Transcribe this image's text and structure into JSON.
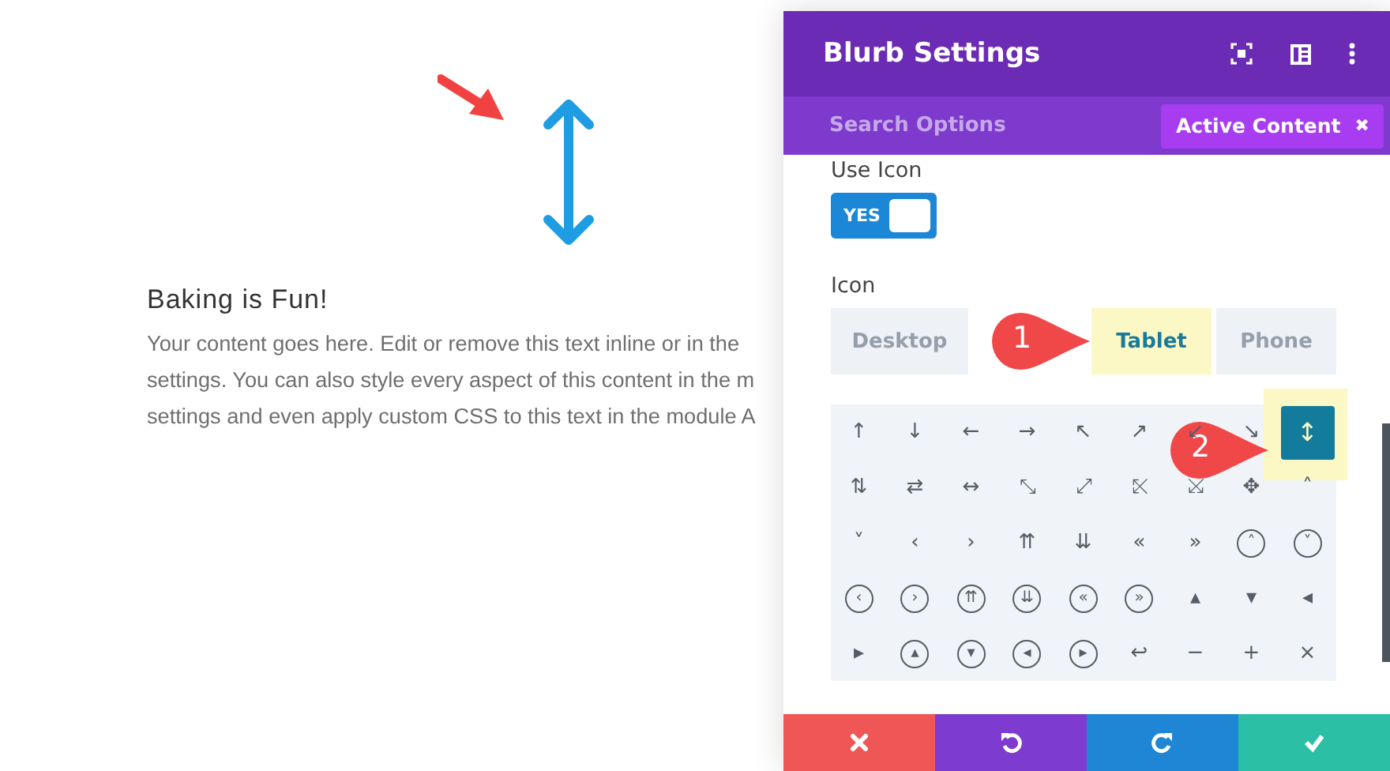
{
  "page": {
    "heading": "Baking is Fun!",
    "body_lines": [
      "Your content goes here. Edit or remove this text inline or in the",
      "settings. You can also style every aspect of this content in the m",
      "settings and even apply custom CSS to this text in the module A"
    ]
  },
  "panel": {
    "title": "Blurb Settings",
    "search": {
      "placeholder": "Search Options"
    },
    "filter_button": {
      "label": "Active Content",
      "close": "✖"
    },
    "use_icon": {
      "label": "Use Icon",
      "toggle": {
        "on": true,
        "label": "YES"
      }
    },
    "icon": {
      "label": "Icon",
      "tabs": [
        {
          "label": "Desktop",
          "selected": false
        },
        {
          "label": "Tablet",
          "selected": true
        },
        {
          "label": "Phone",
          "selected": false
        }
      ],
      "glyphs": [
        {
          "glyph": "↑",
          "kind": "plain",
          "selected": false
        },
        {
          "glyph": "↓",
          "kind": "plain",
          "selected": false
        },
        {
          "glyph": "←",
          "kind": "plain",
          "selected": false
        },
        {
          "glyph": "→",
          "kind": "plain",
          "selected": false
        },
        {
          "glyph": "↖",
          "kind": "plain",
          "selected": false
        },
        {
          "glyph": "↗",
          "kind": "plain",
          "selected": false
        },
        {
          "glyph": "↙",
          "kind": "plain",
          "selected": false
        },
        {
          "glyph": "↘",
          "kind": "plain",
          "selected": false
        },
        {
          "glyph": "↕",
          "kind": "plain",
          "selected": true
        },
        {
          "glyph": "⇅",
          "kind": "plain",
          "selected": false
        },
        {
          "glyph": "⇄",
          "kind": "plain",
          "selected": false
        },
        {
          "glyph": "↔",
          "kind": "plain",
          "selected": false
        },
        {
          "glyph": "⤡",
          "kind": "plain",
          "selected": false
        },
        {
          "glyph": "⤢",
          "kind": "plain",
          "selected": false
        },
        {
          "glyph": "⤪",
          "kind": "plain",
          "selected": false
        },
        {
          "glyph": "⤩",
          "kind": "plain",
          "selected": false
        },
        {
          "glyph": "✥",
          "kind": "plain",
          "selected": false
        },
        {
          "glyph": "˄",
          "kind": "plain",
          "selected": false
        },
        {
          "glyph": "˅",
          "kind": "plain",
          "selected": false
        },
        {
          "glyph": "‹",
          "kind": "plain",
          "selected": false
        },
        {
          "glyph": "›",
          "kind": "plain",
          "selected": false
        },
        {
          "glyph": "⇈",
          "kind": "plain",
          "selected": false
        },
        {
          "glyph": "⇊",
          "kind": "plain",
          "selected": false
        },
        {
          "glyph": "«",
          "kind": "plain",
          "selected": false
        },
        {
          "glyph": "»",
          "kind": "plain",
          "selected": false
        },
        {
          "glyph": "˄",
          "kind": "circled",
          "selected": false
        },
        {
          "glyph": "˅",
          "kind": "circled",
          "selected": false
        },
        {
          "glyph": "‹",
          "kind": "circled",
          "selected": false
        },
        {
          "glyph": "›",
          "kind": "circled",
          "selected": false
        },
        {
          "glyph": "⇈",
          "kind": "circled",
          "selected": false
        },
        {
          "glyph": "⇊",
          "kind": "circled",
          "selected": false
        },
        {
          "glyph": "«",
          "kind": "circled",
          "selected": false
        },
        {
          "glyph": "»",
          "kind": "circled",
          "selected": false
        },
        {
          "glyph": "▴",
          "kind": "plain",
          "selected": false
        },
        {
          "glyph": "▾",
          "kind": "plain",
          "selected": false
        },
        {
          "glyph": "◂",
          "kind": "plain",
          "selected": false
        },
        {
          "glyph": "▸",
          "kind": "plain",
          "selected": false
        },
        {
          "glyph": "▴",
          "kind": "circled",
          "selected": false
        },
        {
          "glyph": "▾",
          "kind": "circled",
          "selected": false
        },
        {
          "glyph": "◂",
          "kind": "circled",
          "selected": false
        },
        {
          "glyph": "▸",
          "kind": "circled",
          "selected": false
        },
        {
          "glyph": "↩",
          "kind": "plain",
          "selected": false
        },
        {
          "glyph": "−",
          "kind": "plain",
          "selected": false
        },
        {
          "glyph": "+",
          "kind": "plain",
          "selected": false
        },
        {
          "glyph": "×",
          "kind": "plain",
          "selected": false
        }
      ]
    },
    "footer_buttons": [
      {
        "kind": "cancel"
      },
      {
        "kind": "undo"
      },
      {
        "kind": "redo"
      },
      {
        "kind": "save"
      }
    ]
  },
  "callouts": [
    {
      "number": "1"
    },
    {
      "number": "2"
    }
  ]
}
